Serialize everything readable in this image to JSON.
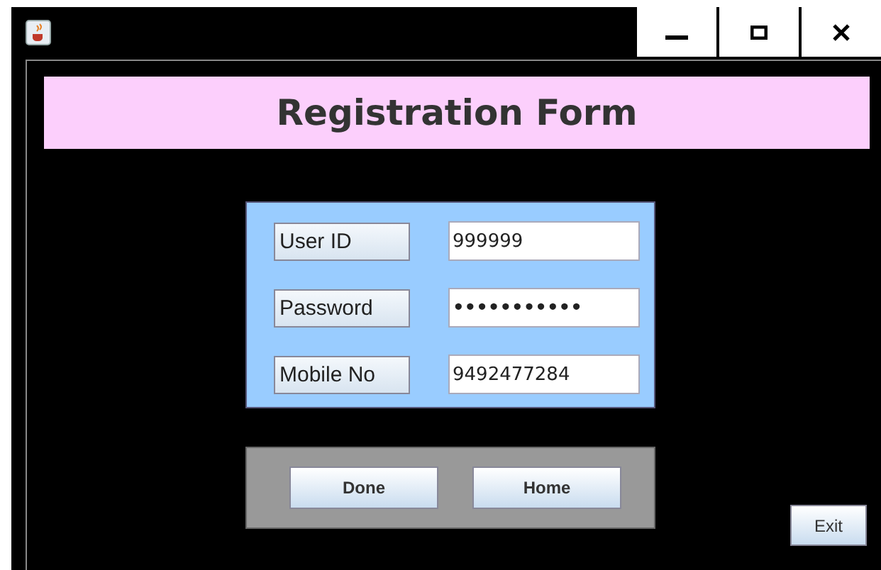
{
  "window": {
    "controls": [
      {
        "kind": "minimize"
      },
      {
        "kind": "maximize"
      },
      {
        "kind": "close"
      }
    ]
  },
  "banner": {
    "title": "Registration Form"
  },
  "fields": [
    {
      "label": "User ID",
      "value": "999999",
      "kind": "text"
    },
    {
      "label": "Password",
      "value": "•••••••••••",
      "kind": "password"
    },
    {
      "label": "Mobile No",
      "value": "9492477284",
      "kind": "text"
    }
  ],
  "actions": [
    "Done",
    "Home"
  ],
  "exit_button": "Exit"
}
